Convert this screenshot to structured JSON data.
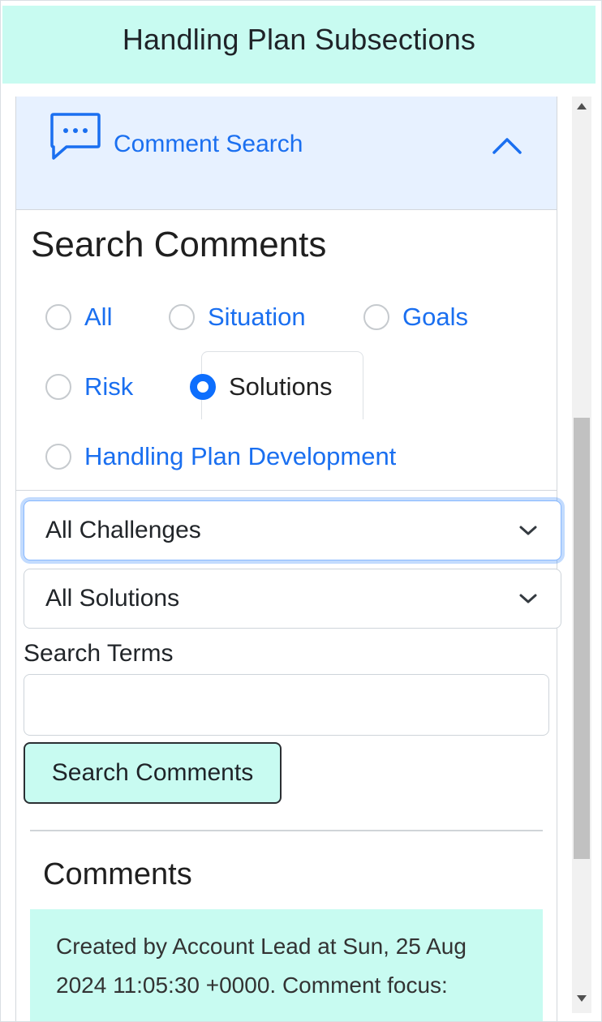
{
  "header": {
    "title": "Handling Plan Subsections"
  },
  "accordion": {
    "title": "Comment Search",
    "icon": "chat-dots-icon",
    "expanded": true
  },
  "search": {
    "title": "Search Comments",
    "categories": [
      {
        "label": "All",
        "checked": false
      },
      {
        "label": "Situation",
        "checked": false
      },
      {
        "label": "Goals",
        "checked": false
      },
      {
        "label": "Risk",
        "checked": false
      },
      {
        "label": "Solutions",
        "checked": true
      },
      {
        "label": "Handling Plan Development",
        "checked": false
      }
    ],
    "challenges_select": "All Challenges",
    "solutions_select": "All Solutions",
    "terms_label": "Search Terms",
    "terms_value": "",
    "button_label": "Search Comments"
  },
  "comments": {
    "title": "Comments",
    "items": [
      {
        "text": "Created by Account Lead at Sun, 25 Aug 2024 11:05:30 +0000. Comment focus:"
      }
    ]
  },
  "colors": {
    "header_bg": "#c8fbf1",
    "accordion_bg": "#e7f1ff",
    "link": "#1a6ff0",
    "radio_checked": "#0d6efd",
    "comment_bg": "#c8fbf1"
  }
}
